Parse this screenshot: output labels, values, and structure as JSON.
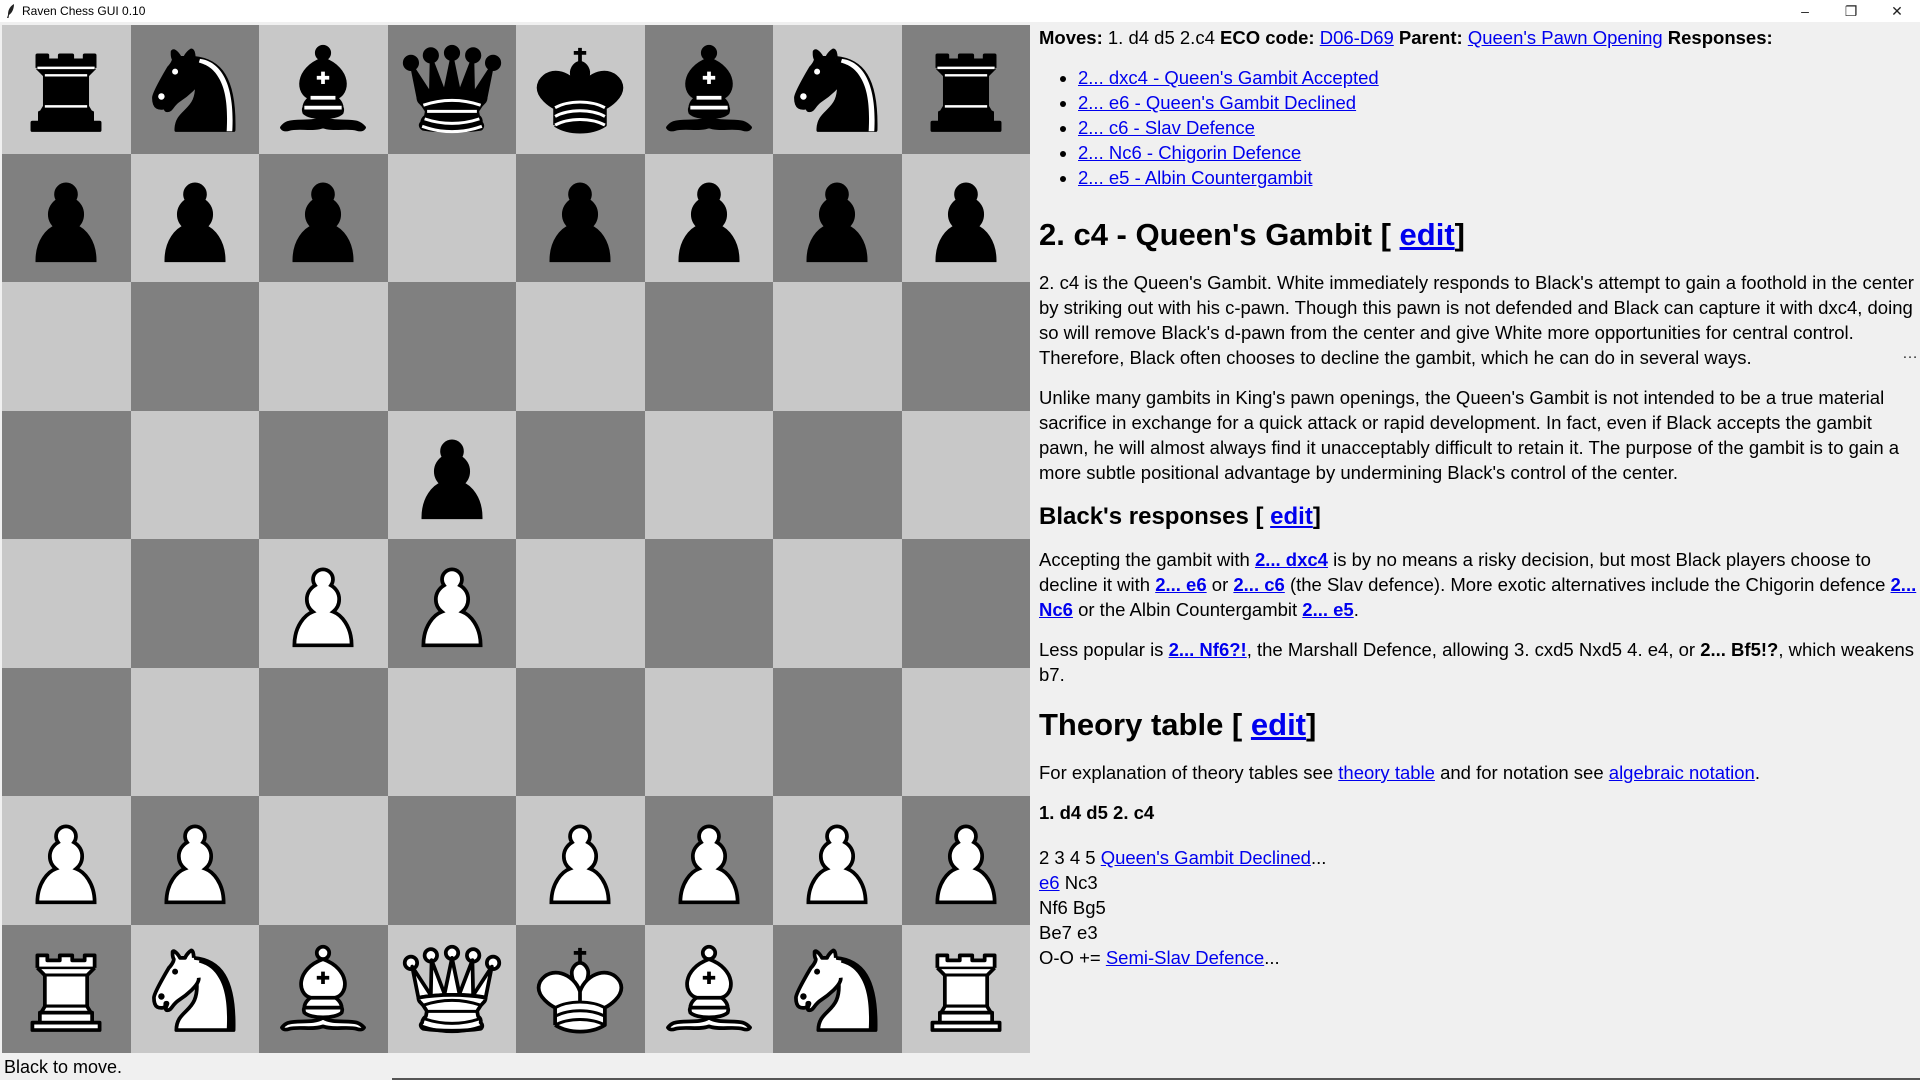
{
  "window": {
    "title": "Raven Chess GUI 0.10",
    "minimize": "–",
    "restore": "❐",
    "close": "✕"
  },
  "board": {
    "ranks": [
      [
        "bR",
        "bN",
        "bB",
        "bQ",
        "bK",
        "bB",
        "bN",
        "bR"
      ],
      [
        "bP",
        "bP",
        "bP",
        "",
        "bP",
        "bP",
        "bP",
        "bP"
      ],
      [
        "",
        "",
        "",
        "",
        "",
        "",
        "",
        ""
      ],
      [
        "",
        "",
        "",
        "bP",
        "",
        "",
        "",
        ""
      ],
      [
        "",
        "",
        "wP",
        "wP",
        "",
        "",
        "",
        ""
      ],
      [
        "",
        "",
        "",
        "",
        "",
        "",
        "",
        ""
      ],
      [
        "wP",
        "wP",
        "",
        "",
        "wP",
        "wP",
        "wP",
        "wP"
      ],
      [
        "wR",
        "wN",
        "wB",
        "wQ",
        "wK",
        "wB",
        "wN",
        "wR"
      ]
    ],
    "light_color": "#c8c8c8",
    "dark_color": "#808080"
  },
  "status": "Black to move.",
  "header": {
    "moves_label": "Moves:",
    "moves_value": "1. d4 d5 2.c4",
    "eco_label": "ECO code:",
    "eco_link": "D06-D69",
    "parent_label": "Parent:",
    "parent_link": "Queen's Pawn Opening",
    "responses_label": "Responses:"
  },
  "responses": [
    "2... dxc4 - Queen's Gambit Accepted",
    "2... e6 - Queen's Gambit Declined",
    "2... c6 - Slav Defence",
    "2... Nc6 - Chigorin Defence",
    "2... e5 - Albin Countergambit"
  ],
  "section1": {
    "title": "2. c4 - Queen's Gambit [",
    "edit": "edit",
    "close": "]",
    "p1": "2. c4 is the Queen's Gambit. White immediately responds to Black's attempt to gain a foothold in the center by striking out with his c-pawn. Though this pawn is not defended and Black can capture it with dxc4, doing so will remove Black's d-pawn from the center and give White more opportunities for central control. Therefore, Black often chooses to decline the gambit, which he can do in several ways.",
    "p2": "Unlike many gambits in King's pawn openings, the Queen's Gambit is not intended to be a true material sacrifice in exchange for a quick attack or rapid development. In fact, even if Black accepts the gambit pawn, he will almost always find it unacceptably difficult to retain it. The purpose of the gambit is to gain a more subtle positional advantage by undermining Black's control of the center."
  },
  "section2": {
    "title": "Black's responses [",
    "edit": "edit",
    "close": "]",
    "p1_a": "Accepting the gambit with",
    "p1_l1": "2... dxc4",
    "p1_b": "is by no means a risky decision, but most Black players choose to decline it with",
    "p1_l2": "2... e6",
    "p1_c": "or",
    "p1_l3": "2... c6",
    "p1_d": "(the Slav defence). More exotic alternatives include the Chigorin defence",
    "p1_l4": "2... Nc6",
    "p1_e": "or the Albin Countergambit",
    "p1_l5": "2... e5",
    "p1_f": ".",
    "p2_a": "Less popular is",
    "p2_l1": "2... Nf6?!",
    "p2_b": ", the Marshall Defence, allowing 3. cxd5 Nxd5 4. e4, or",
    "p2_bold": "2... Bf5!?",
    "p2_c": ", which weakens b7."
  },
  "section3": {
    "title": "Theory table [",
    "edit": "edit",
    "close": "]",
    "p1_a": "For explanation of theory tables see",
    "p1_l1": "theory table",
    "p1_b": "and for notation see",
    "p1_l2": "algebraic notation",
    "p1_c": ".",
    "moves_bold": "1. d4 d5 2. c4",
    "line1_a": "2 3 4 5",
    "line1_link": "Queen's Gambit Declined",
    "line1_b": "...",
    "line2_link": "e6",
    "line2_b": "Nc3",
    "line3": "Nf6 Bg5",
    "line4": "Be7 e3",
    "line5_a": "O-O +=",
    "line5_link": "Semi-Slav Defence",
    "line5_b": "..."
  },
  "scroll_indicator": "…"
}
